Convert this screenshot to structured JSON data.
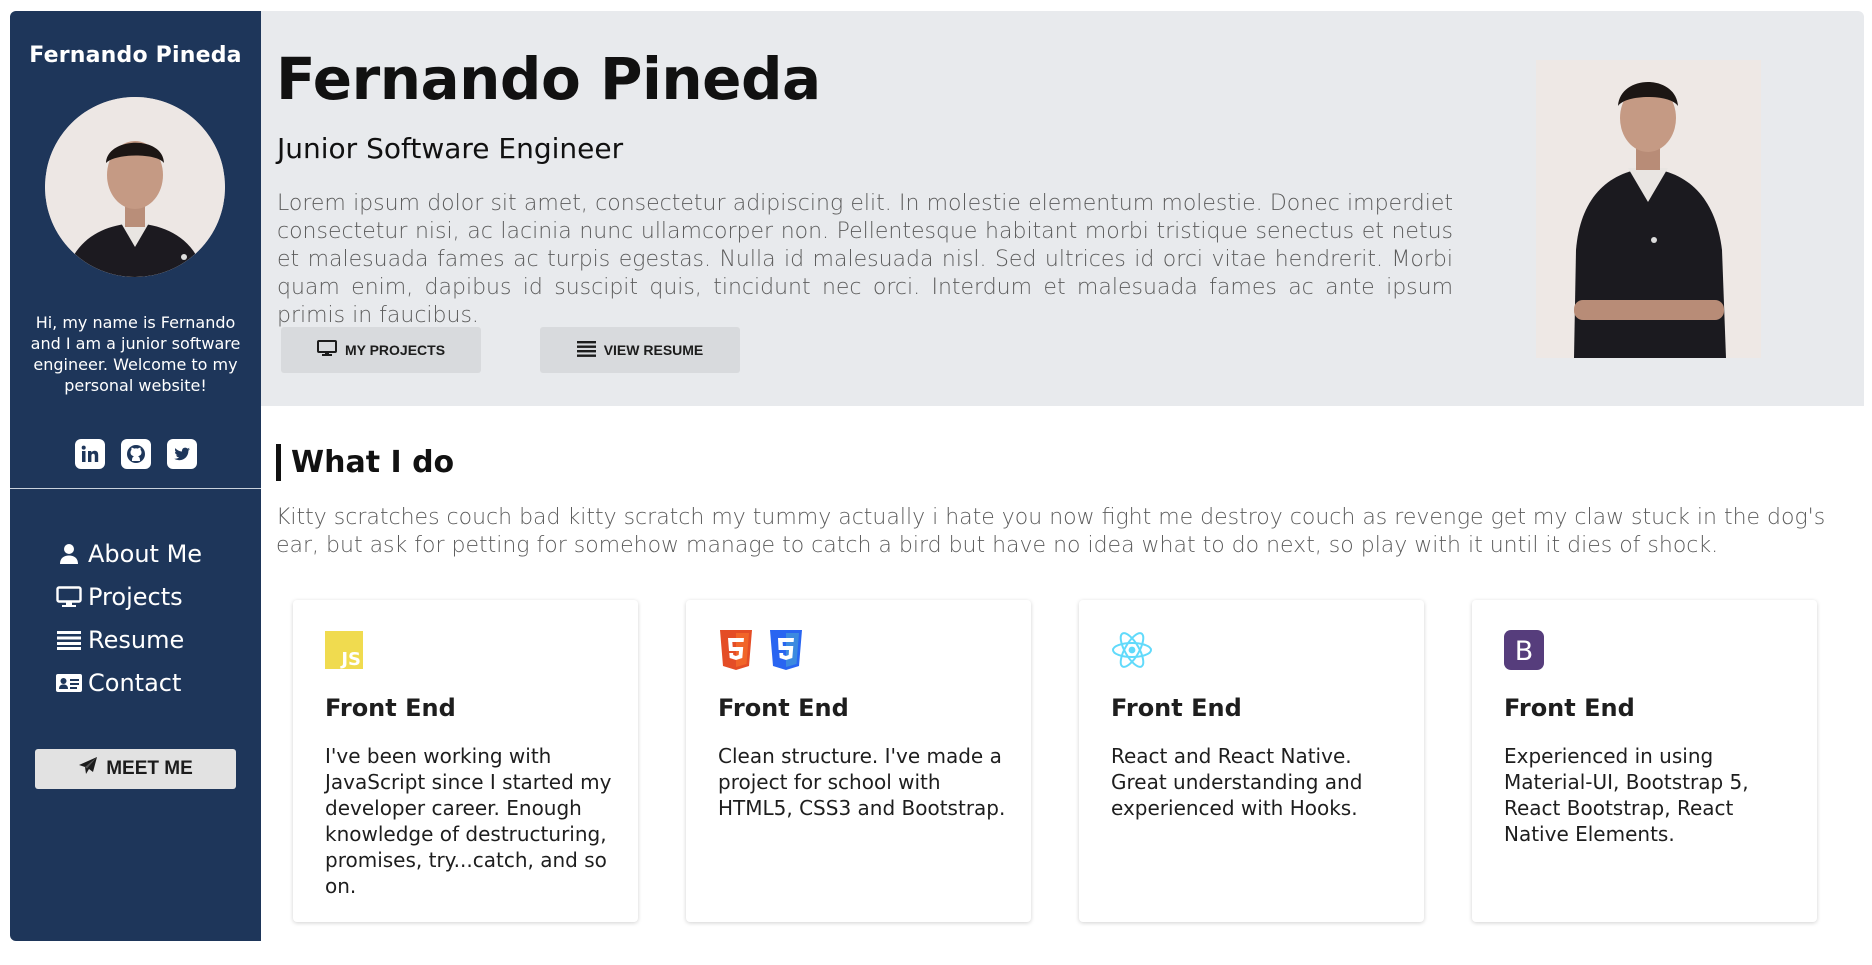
{
  "sidebar": {
    "name": "Fernando Pineda",
    "intro": "Hi, my name is Fernando and I am a junior software engineer. Welcome to my personal website!",
    "social": [
      "linkedin-icon",
      "github-icon",
      "twitter-icon"
    ],
    "nav": [
      {
        "label": "About Me",
        "icon": "user-icon"
      },
      {
        "label": "Projects",
        "icon": "monitor-icon"
      },
      {
        "label": "Resume",
        "icon": "list-icon"
      },
      {
        "label": "Contact",
        "icon": "address-card-icon"
      }
    ],
    "meet_label": "MEET ME"
  },
  "hero": {
    "name": "Fernando Pineda",
    "role": "Junior Software Engineer",
    "description": "Lorem ipsum dolor sit amet, consectetur adipiscing elit. In molestie elementum molestie. Donec imperdiet consectetur nisi, ac lacinia nunc ullamcorper non. Pellentesque habitant morbi tristique senectus et netus et malesuada fames ac turpis egestas. Nulla id malesuada nisl. Sed ultrices id orci vitae hendrerit. Morbi quam enim, dapibus id suscipit quis, tincidunt nec orci. Interdum et malesuada fames ac ante ipsum primis in faucibus.",
    "projects_label": "MY PROJECTS",
    "resume_label": "VIEW RESUME"
  },
  "whatido": {
    "title": "What I do",
    "text": "Kitty scratches couch bad kitty scratch my tummy actually i hate you now fight me destroy couch as revenge get my claw stuck in the dog's ear, but ask for petting for somehow manage to catch a bird but have no idea what to do next, so play with it until it dies of shock.",
    "cards": [
      {
        "title": "Front End",
        "text": "I've been working with JavaScript since I started my developer career. Enough knowledge of destructuring, promises, try...catch, and so on.",
        "icons": [
          "js-icon"
        ]
      },
      {
        "title": "Front End",
        "text": "Clean structure. I've made a project for school with HTML5, CSS3 and Bootstrap.",
        "icons": [
          "html5-icon",
          "css3-icon"
        ]
      },
      {
        "title": "Front End",
        "text": "React and React Native. Great understanding and experienced with Hooks.",
        "icons": [
          "react-icon"
        ]
      },
      {
        "title": "Front End",
        "text": "Experienced in using Material-UI, Bootstrap 5, React Bootstrap, React Native Elements.",
        "icons": [
          "bootstrap-icon"
        ]
      }
    ],
    "icon_text": {
      "js": "JS",
      "bootstrap": "B"
    }
  },
  "colors": {
    "sidebar_bg": "#1e365a",
    "hero_bg": "#e8eaed",
    "button_bg": "#d8dadd",
    "js_yellow": "#f0db4f",
    "html_orange": "#e44d26",
    "css_blue": "#2965f1",
    "react_cyan": "#61dafb",
    "bootstrap_purple": "#563d7c"
  }
}
